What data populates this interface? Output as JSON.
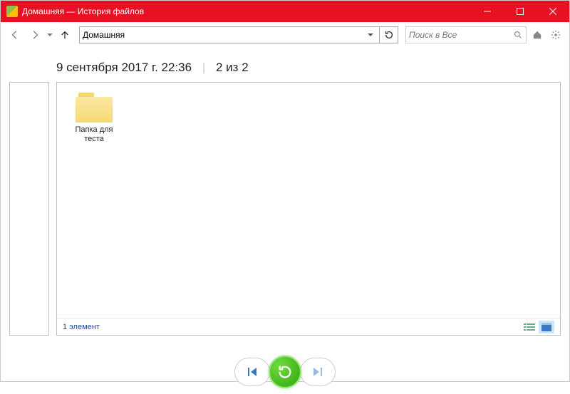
{
  "window": {
    "title": "Домашняя — История файлов"
  },
  "toolbar": {
    "address": "Домашняя",
    "search_placeholder": "Поиск в Все"
  },
  "header": {
    "timestamp": "9 сентября 2017 г. 22:36",
    "counter": "2 из 2"
  },
  "content": {
    "items": [
      {
        "name": "Папка для теста"
      }
    ],
    "status": "1 элемент"
  },
  "icons": {
    "back": "back-arrow",
    "forward": "forward-arrow",
    "up": "up-arrow",
    "refresh": "refresh",
    "home": "home",
    "settings": "gear",
    "prev_version": "prev",
    "restore": "restore",
    "next_version": "next"
  }
}
